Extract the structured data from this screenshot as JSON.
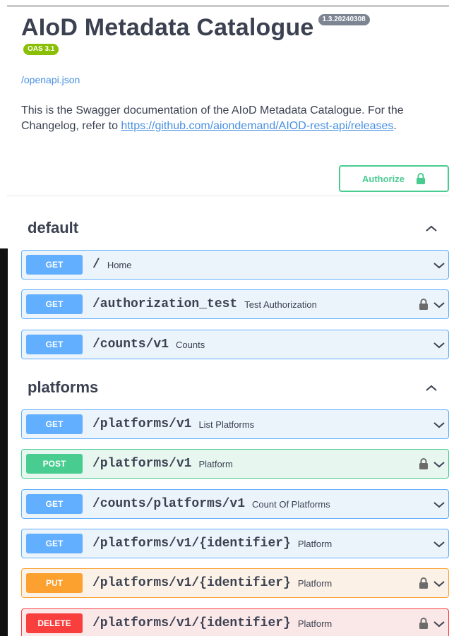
{
  "info": {
    "title": "AIoD Metadata Catalogue",
    "version": "1.3.20240308",
    "oas_version": "OAS 3.1",
    "spec_link": "/openapi.json",
    "description": "This is the Swagger documentation of the AIoD Metadata Catalogue. For the Changelog, refer to ",
    "changelog_link": "https://github.com/aiondemand/AIOD-rest-api/releases",
    "description_end": "."
  },
  "authorize": {
    "label": "Authorize",
    "icon": "lock-icon"
  },
  "colors": {
    "get": "#61affe",
    "post": "#49cc90",
    "put": "#fca130",
    "delete": "#f93e3e",
    "link": "#4990e2",
    "oas_badge": "#89bf04"
  },
  "sections": [
    {
      "name": "default",
      "expanded": true,
      "operations": [
        {
          "method": "GET",
          "path": "/",
          "summary": "Home",
          "locked": false
        },
        {
          "method": "GET",
          "path": "/authorization_test",
          "summary": "Test Authorization",
          "locked": true
        },
        {
          "method": "GET",
          "path": "/counts/v1",
          "summary": "Counts",
          "locked": false
        }
      ]
    },
    {
      "name": "platforms",
      "expanded": true,
      "operations": [
        {
          "method": "GET",
          "path": "/platforms/v1",
          "summary": "List Platforms",
          "locked": false
        },
        {
          "method": "POST",
          "path": "/platforms/v1",
          "summary": "Platform",
          "locked": true
        },
        {
          "method": "GET",
          "path": "/counts/platforms/v1",
          "summary": "Count Of Platforms",
          "locked": false
        },
        {
          "method": "GET",
          "path": "/platforms/v1/{identifier}",
          "summary": "Platform",
          "locked": false
        },
        {
          "method": "PUT",
          "path": "/platforms/v1/{identifier}",
          "summary": "Platform",
          "locked": true
        },
        {
          "method": "DELETE",
          "path": "/platforms/v1/{identifier}",
          "summary": "Platform",
          "locked": true
        }
      ]
    }
  ]
}
